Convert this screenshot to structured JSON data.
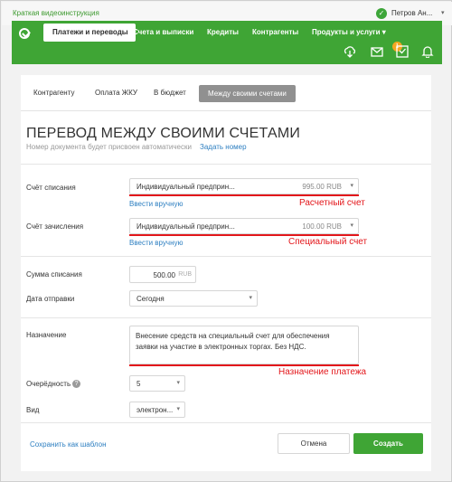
{
  "topbar": {
    "video_link": "Краткая видеоинструкция",
    "user_name": "Петров Ан...",
    "user_check_icon": "check-circle-icon"
  },
  "nav": {
    "items": [
      {
        "label": "Платежи и переводы",
        "active": true
      },
      {
        "label": "Счета и выписки"
      },
      {
        "label": "Кредиты"
      },
      {
        "label": "Контрагенты"
      },
      {
        "label": "Продукты и услуги ▾"
      }
    ],
    "icons": [
      "download-icon",
      "mail-icon",
      "inbox-check-icon",
      "bell-icon"
    ],
    "mail_badge": "1",
    "brand_color": "#3fa535"
  },
  "tabs": [
    {
      "label": "Контрагенту"
    },
    {
      "label": "Оплата ЖКУ"
    },
    {
      "label": "В бюджет"
    },
    {
      "label": "Между своими счетами",
      "active": true
    }
  ],
  "form": {
    "title": "ПЕРЕВОД МЕЖДУ СВОИМИ СЧЕТАМИ",
    "doc_number_note": "Номер документа будет присвоен автоматически",
    "assign_number_link": "Задать номер",
    "debit_account": {
      "label": "Счёт списания",
      "value": "Индивидуальный предприн...",
      "amount": "995.00 RUB",
      "manual_link": "Ввести вручную",
      "annotation": "Расчетный счет"
    },
    "credit_account": {
      "label": "Счёт зачисления",
      "value": "Индивидуальный предприн...",
      "amount": "100.00 RUB",
      "manual_link": "Ввести вручную",
      "annotation": "Специальный счет"
    },
    "amount": {
      "label": "Сумма списания",
      "value": "500.00",
      "currency": "RUB"
    },
    "send_date": {
      "label": "Дата отправки",
      "value": "Сегодня"
    },
    "purpose": {
      "label": "Назначение",
      "value": "Внесение средств на специальный счет для обеспечения заявки на участие в электронных торгах. Без НДС.",
      "annotation": "Назначение платежа"
    },
    "priority": {
      "label": "Очерёдность",
      "value": "5",
      "info_icon": "?"
    },
    "kind": {
      "label": "Вид",
      "value": "электрон..."
    },
    "save_template": "Сохранить как шаблон",
    "cancel": "Отмена",
    "create": "Создать"
  },
  "annotation_color": "#e3171b"
}
